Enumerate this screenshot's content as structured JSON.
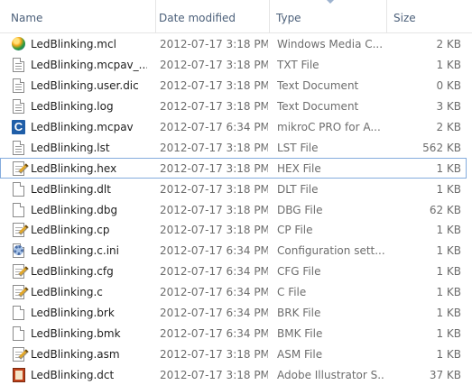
{
  "columns": {
    "name": "Name",
    "date": "Date modified",
    "type": "Type",
    "size": "Size"
  },
  "files": [
    {
      "name": "LedBlinking.mcl",
      "date": "2012-07-17 3:18 PM",
      "type": "Windows Media C...",
      "size": "2 KB",
      "icon": "media-player-icon"
    },
    {
      "name": "LedBlinking.mcpav_...",
      "date": "2012-07-17 3:18 PM",
      "type": "TXT File",
      "size": "1 KB",
      "icon": "text-document-icon"
    },
    {
      "name": "LedBlinking.user.dic",
      "date": "2012-07-17 3:18 PM",
      "type": "Text Document",
      "size": "0 KB",
      "icon": "text-document-icon"
    },
    {
      "name": "LedBlinking.log",
      "date": "2012-07-17 3:18 PM",
      "type": "Text Document",
      "size": "3 KB",
      "icon": "text-document-icon"
    },
    {
      "name": "LedBlinking.mcpav",
      "date": "2012-07-17 6:34 PM",
      "type": "mikroC PRO for A...",
      "size": "2 KB",
      "icon": "mikroc-icon"
    },
    {
      "name": "LedBlinking.lst",
      "date": "2012-07-17 3:18 PM",
      "type": "LST File",
      "size": "562 KB",
      "icon": "text-document-icon"
    },
    {
      "name": "LedBlinking.hex",
      "date": "2012-07-17 3:18 PM",
      "type": "HEX File",
      "size": "1 KB",
      "icon": "edit-document-icon"
    },
    {
      "name": "LedBlinking.dlt",
      "date": "2012-07-17 3:18 PM",
      "type": "DLT File",
      "size": "1 KB",
      "icon": "blank-document-icon"
    },
    {
      "name": "LedBlinking.dbg",
      "date": "2012-07-17 3:18 PM",
      "type": "DBG File",
      "size": "62 KB",
      "icon": "blank-document-icon"
    },
    {
      "name": "LedBlinking.cp",
      "date": "2012-07-17 3:18 PM",
      "type": "CP File",
      "size": "1 KB",
      "icon": "edit-document-icon"
    },
    {
      "name": "LedBlinking.c.ini",
      "date": "2012-07-17 6:34 PM",
      "type": "Configuration sett...",
      "size": "1 KB",
      "icon": "settings-gear-icon"
    },
    {
      "name": "LedBlinking.cfg",
      "date": "2012-07-17 6:34 PM",
      "type": "CFG File",
      "size": "1 KB",
      "icon": "edit-document-icon"
    },
    {
      "name": "LedBlinking.c",
      "date": "2012-07-17 6:34 PM",
      "type": "C File",
      "size": "1 KB",
      "icon": "edit-document-icon"
    },
    {
      "name": "LedBlinking.brk",
      "date": "2012-07-17 6:34 PM",
      "type": "BRK File",
      "size": "1 KB",
      "icon": "blank-document-icon"
    },
    {
      "name": "LedBlinking.bmk",
      "date": "2012-07-17 6:34 PM",
      "type": "BMK File",
      "size": "1 KB",
      "icon": "blank-document-icon"
    },
    {
      "name": "LedBlinking.asm",
      "date": "2012-07-17 3:18 PM",
      "type": "ASM File",
      "size": "1 KB",
      "icon": "edit-document-icon"
    },
    {
      "name": "LedBlinking.dct",
      "date": "2012-07-17 3:18 PM",
      "type": "Adobe Illustrator S...",
      "size": "37 KB",
      "icon": "illustrator-icon"
    }
  ],
  "selected_index": 6,
  "colors": {
    "header_text": "#4c607a",
    "selection_border": "#84acdd",
    "secondary_text": "#6d6d6d"
  }
}
